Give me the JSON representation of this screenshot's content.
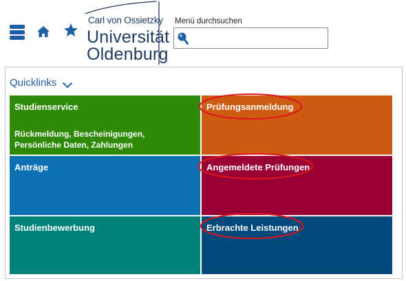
{
  "header": {
    "logo": {
      "line1": "Carl von Ossietzky",
      "line2": "Universität",
      "line3": "Oldenburg"
    },
    "search": {
      "label": "Menü durchsuchen",
      "value": "",
      "placeholder": ""
    },
    "icons": {
      "menu": "menu-icon",
      "home": "home-icon",
      "favorites": "star-icon",
      "search": "search-icon"
    }
  },
  "quicklinks": {
    "title": "Quicklinks",
    "tiles": [
      {
        "title": "Studienservice",
        "description": "Rückmeldung, Bescheinigungen, Persönliche Daten, Zahlungen",
        "color": "#2f8a0a"
      },
      {
        "title": "Prüfungsanmeldung",
        "color": "#cd5b12",
        "highlighted": true
      },
      {
        "title": "Anträge",
        "color": "#0d6fb4"
      },
      {
        "title": "Angemeldete Prüfungen",
        "color": "#990034",
        "highlighted": true
      },
      {
        "title": "Studienbewerbung",
        "color": "#00827a"
      },
      {
        "title": "Erbrachte Leistungen",
        "color": "#00497a",
        "highlighted": true
      }
    ]
  },
  "colors": {
    "accent": "#1f5fa6",
    "highlight_ring": "#e0141e"
  }
}
